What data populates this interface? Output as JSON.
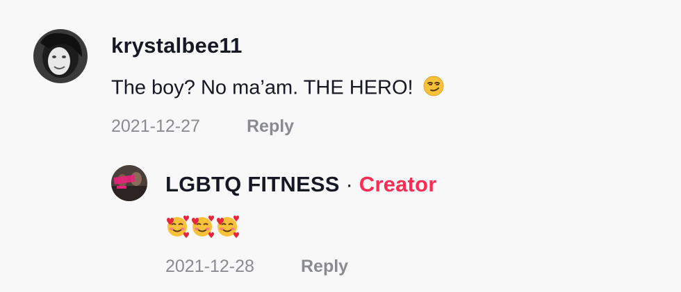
{
  "comments": [
    {
      "username": "krystalbee11",
      "text": "The boy? No ma’am. THE HERO!",
      "emoji": "😏",
      "date": "2021-12-27",
      "reply_label": "Reply"
    }
  ],
  "replies": [
    {
      "username": "LGBTQ FITNESS",
      "separator": "·",
      "badge": "Creator",
      "emoji_text": "🥰🥰🥰",
      "date": "2021-12-28",
      "reply_label": "Reply"
    }
  ],
  "colors": {
    "background": "#f8f8f8",
    "text": "#161823",
    "muted": "#8a8b91",
    "creator_badge": "#fe2c55"
  }
}
